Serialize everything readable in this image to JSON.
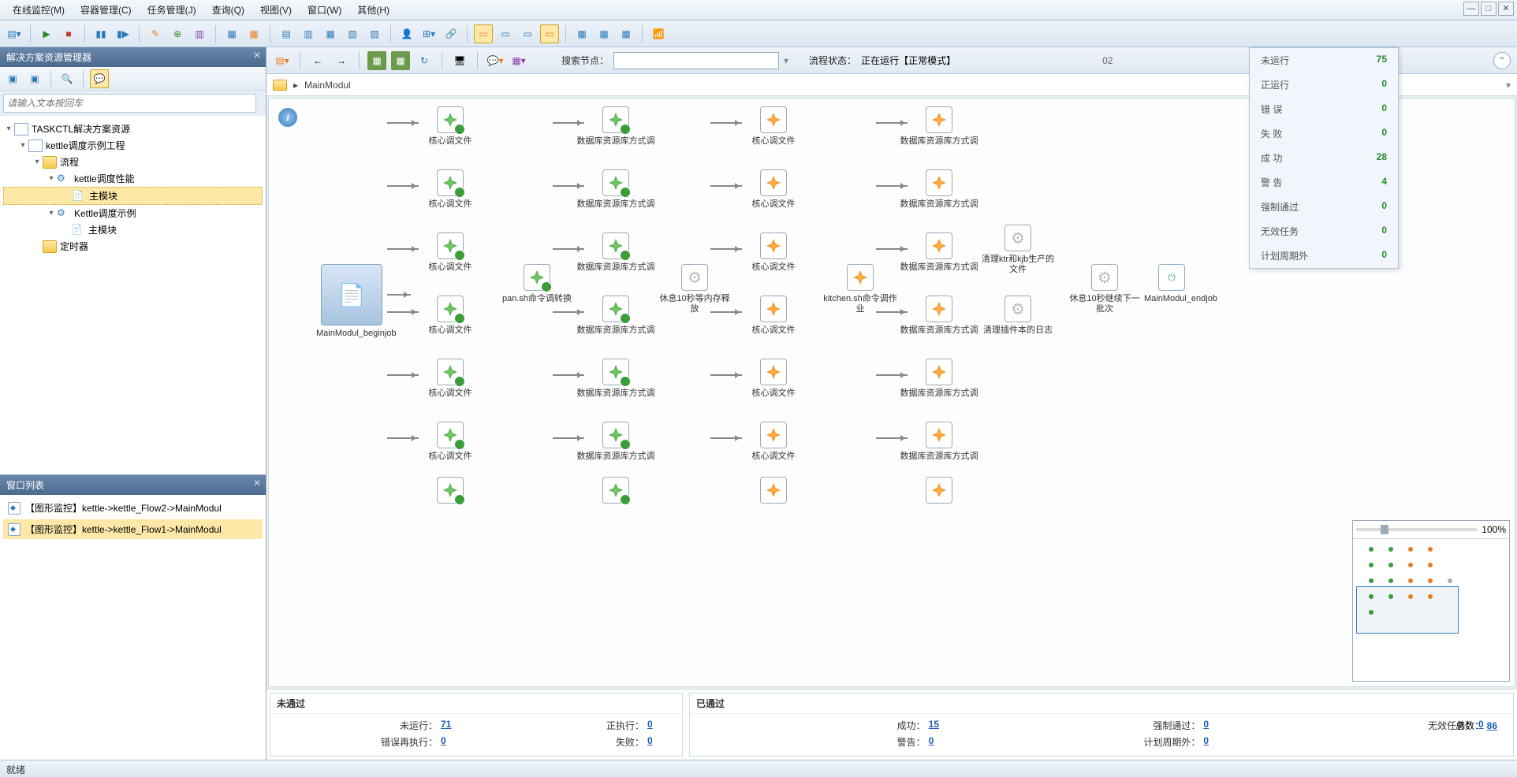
{
  "menu": {
    "items": [
      "在线监控(M)",
      "容器管理(C)",
      "任务管理(J)",
      "查询(Q)",
      "视图(V)",
      "窗口(W)",
      "其他(H)"
    ]
  },
  "solution_panel": {
    "title": "解决方案资源管理器",
    "search_placeholder": "请输入文本按回车",
    "tree": {
      "root": "TASKCTL解决方案资源",
      "proj": "kettle调度示例工程",
      "flow": "流程",
      "perf": "kettle调度性能",
      "main1": "主模块",
      "demo": "Kettle调度示例",
      "main2": "主模块",
      "timer": "定时器"
    }
  },
  "window_panel": {
    "title": "窗口列表",
    "items": [
      "【图形监控】kettle->kettle_Flow2->MainModul",
      "【图形监控】kettle->kettle_Flow1->MainModul"
    ]
  },
  "subbar": {
    "search_label": "搜索节点：",
    "state_label": "流程状态：",
    "state_value": "正在运行【正常模式】",
    "extra": "02"
  },
  "breadcrumb": {
    "path": "MainModul"
  },
  "popup": {
    "rows": [
      {
        "k": "未运行",
        "v": "75"
      },
      {
        "k": "正运行",
        "v": "0"
      },
      {
        "k": "错 误",
        "v": "0"
      },
      {
        "k": "失 败",
        "v": "0"
      },
      {
        "k": "成 功",
        "v": "28"
      },
      {
        "k": "警 告",
        "v": "4"
      },
      {
        "k": "强制通过",
        "v": "0"
      },
      {
        "k": "无效任务",
        "v": "0"
      },
      {
        "k": "计划周期外",
        "v": "0"
      }
    ]
  },
  "nodes": {
    "start": "MainModul_beginjob",
    "core": "核心调文件",
    "db": "数据库资源库方式调",
    "pan": "pan.sh命令调转换",
    "sleep": "休息10秒等内存释放",
    "kitchen": "kitchen.sh命令调作业",
    "clean_ktr": "清理ktr和kjb生产的文件",
    "clean_log": "清理插件本的日志",
    "sleep2": "休息10秒继续下一批次",
    "end": "MainModul_endjob"
  },
  "zoom": {
    "value": "100%"
  },
  "summary": {
    "left_title": "未通过",
    "right_title": "已通过",
    "left": {
      "not_run_k": "未运行：",
      "not_run_v": "71",
      "running_k": "正执行：",
      "running_v": "0",
      "err_retry_k": "错误再执行：",
      "err_retry_v": "0",
      "fail_k": "失败：",
      "fail_v": "0"
    },
    "right": {
      "success_k": "成功：",
      "success_v": "15",
      "force_k": "强制通过：",
      "force_v": "0",
      "invalid_k": "无效任务：",
      "invalid_v": "0",
      "warn_k": "警告：",
      "warn_v": "0",
      "out_k": "计划周期外：",
      "out_v": "0"
    },
    "total_k": "总数：",
    "total_v": "86"
  },
  "statusbar": {
    "text": "就绪"
  }
}
